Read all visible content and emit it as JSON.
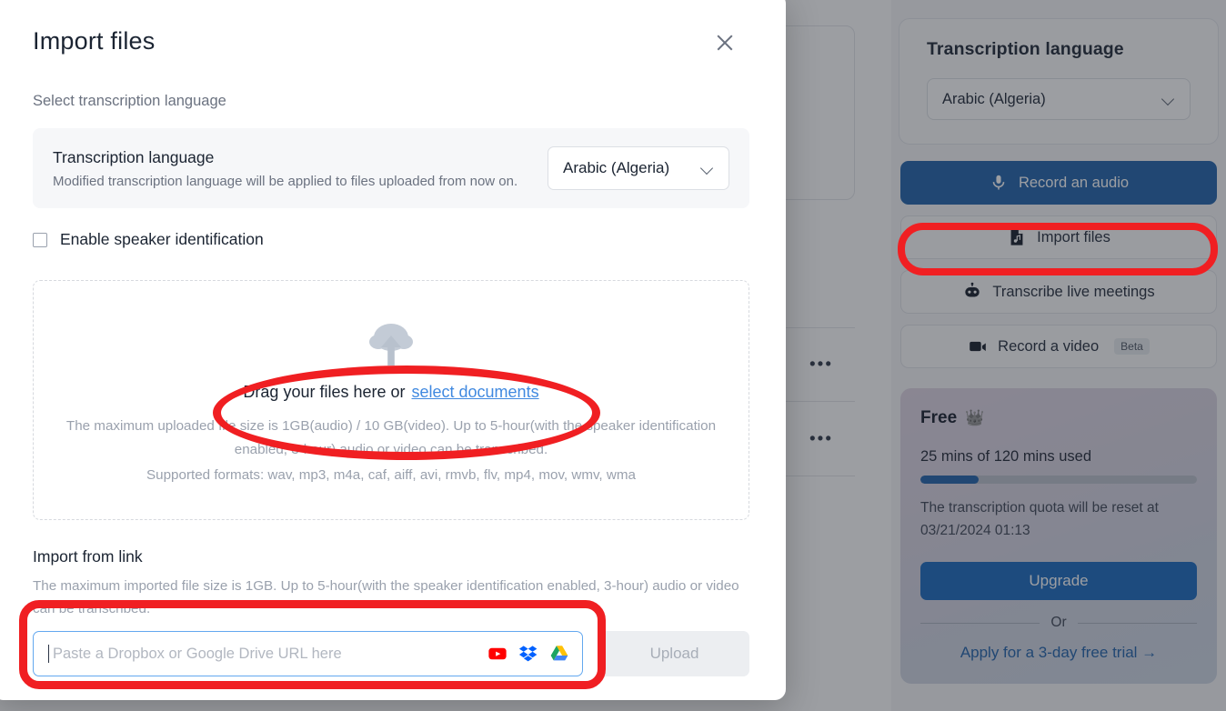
{
  "modal": {
    "title": "Import files",
    "close_icon": "close-icon",
    "section_label": "Select transcription language",
    "language_row": {
      "title": "Transcription language",
      "subtitle": "Modified transcription language will be applied to files uploaded from now on.",
      "selected": "Arabic (Algeria)",
      "chevron_icon": "chevron-down-icon"
    },
    "speaker_checkbox": {
      "label": "Enable speaker identification",
      "checked": false
    },
    "dropzone": {
      "cloud_icon": "cloud-upload-icon",
      "drag_text": "Drag your files here or",
      "select_link": "select documents",
      "size_note": "The maximum uploaded file size is 1GB(audio) / 10 GB(video). Up to 5-hour(with the speaker identification enabled, 3-hour) audio or video can be transcribed.",
      "formats_note": "Supported formats: wav, mp3, m4a, caf, aiff, avi, rmvb, flv, mp4, mov, wmv, wma"
    },
    "import_link": {
      "title": "Import from link",
      "subtitle": "The maximum imported file size is 1GB. Up to 5-hour(with the speaker identification enabled, 3-hour) audio or video can be transcribed.",
      "input_placeholder": "Paste a Dropbox or Google Drive URL here",
      "input_value": "",
      "service_icons": [
        "youtube-icon",
        "dropbox-icon",
        "google-drive-icon"
      ],
      "upload_label": "Upload"
    }
  },
  "sidebar": {
    "language_card": {
      "title": "Transcription language",
      "selected": "Arabic (Algeria)",
      "chevron_icon": "chevron-down-icon"
    },
    "actions": [
      {
        "label": "Record an audio",
        "icon": "microphone-icon",
        "primary": true
      },
      {
        "label": "Import files",
        "icon": "audio-file-icon",
        "primary": false
      },
      {
        "label": "Transcribe live meetings",
        "icon": "robot-icon",
        "primary": false
      },
      {
        "label": "Record a video",
        "icon": "video-camera-icon",
        "primary": false,
        "badge": "Beta"
      }
    ],
    "plan": {
      "name": "Free",
      "crown_icon": "crown-icon",
      "usage_text": "25 mins of 120 mins used",
      "usage_percent": 21,
      "reset_text_line1": "The transcription quota will be reset at",
      "reset_text_line2": "03/21/2024 01:13",
      "upgrade_label": "Upgrade",
      "or_label": "Or",
      "trial_label": "Apply for a 3-day free trial →"
    }
  },
  "background": {
    "row_menu_icon": "more-options-icon",
    "row_menu_glyph": "•••"
  },
  "colors": {
    "accent_blue": "#1d5fa8",
    "link_blue": "#1c5fa8",
    "annotation_red": "#f01f22",
    "scrim": "rgba(40,44,52,0.46)"
  }
}
